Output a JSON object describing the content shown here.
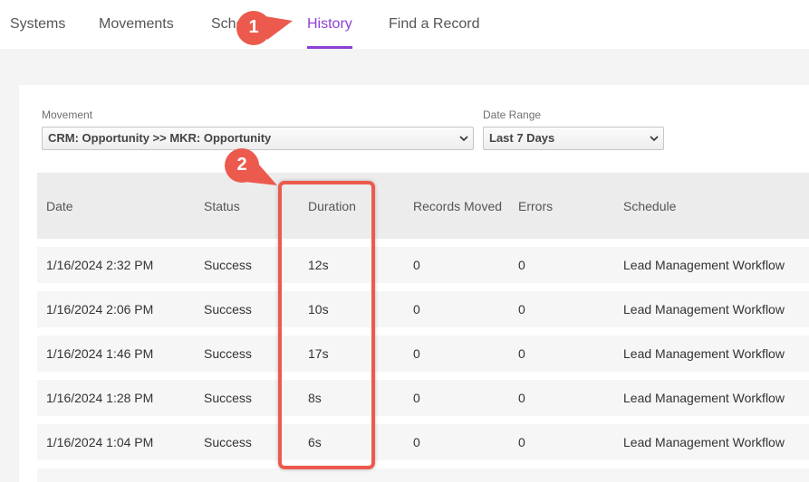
{
  "nav": {
    "tabs": [
      {
        "label": "Systems"
      },
      {
        "label": "Movements"
      },
      {
        "label": "Sche"
      },
      {
        "label": "History"
      },
      {
        "label": "Find a Record"
      }
    ],
    "active_tab": "History",
    "accent_color": "#8e3fd6"
  },
  "filters": {
    "movement_label": "Movement",
    "movement_value": "CRM: Opportunity >> MKR: Opportunity",
    "date_range_label": "Date Range",
    "date_range_value": "Last 7 Days"
  },
  "table": {
    "headers": [
      "Date",
      "Status",
      "Duration",
      "Records Moved",
      "Errors",
      "Schedule"
    ],
    "rows": [
      [
        "1/16/2024 2:32 PM",
        "Success",
        "12s",
        "0",
        "0",
        "Lead Management Workflow"
      ],
      [
        "1/16/2024 2:06 PM",
        "Success",
        "10s",
        "0",
        "0",
        "Lead Management Workflow"
      ],
      [
        "1/16/2024 1:46 PM",
        "Success",
        "17s",
        "0",
        "0",
        "Lead Management Workflow"
      ],
      [
        "1/16/2024 1:28 PM",
        "Success",
        "8s",
        "0",
        "0",
        "Lead Management Workflow"
      ],
      [
        "1/16/2024 1:04 PM",
        "Success",
        "6s",
        "0",
        "0",
        "Lead Management Workflow"
      ]
    ]
  },
  "annotations": {
    "marker_1": "1",
    "marker_2": "2",
    "marker_color": "#ec5a4e"
  }
}
